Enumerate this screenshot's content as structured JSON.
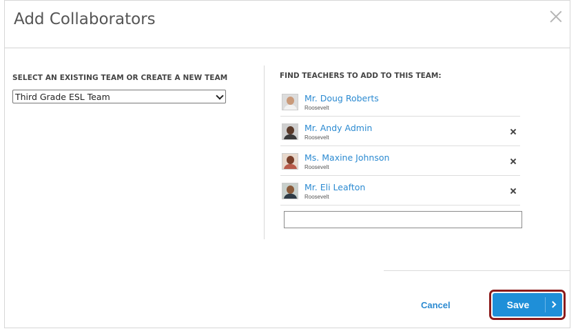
{
  "dialog": {
    "title": "Add Collaborators"
  },
  "left": {
    "label": "SELECT AN EXISTING TEAM OR CREATE A NEW TEAM",
    "selected_team": "Third Grade ESL Team"
  },
  "right": {
    "label": "FIND TEACHERS TO ADD TO THIS TEAM:",
    "teachers": [
      {
        "name": "Mr. Doug Roberts",
        "school": "Roosevelt",
        "removable": false
      },
      {
        "name": "Mr. Andy Admin",
        "school": "Roosevelt",
        "removable": true
      },
      {
        "name": "Ms. Maxine Johnson",
        "school": "Roosevelt",
        "removable": true
      },
      {
        "name": "Mr. Eli Leafton",
        "school": "Roosevelt",
        "removable": true
      }
    ],
    "search_value": ""
  },
  "footer": {
    "cancel_label": "Cancel",
    "save_label": "Save"
  },
  "colors": {
    "link": "#2b8ad1",
    "primary_button": "#1f8fd8",
    "highlight_outline": "#8b1a1a"
  },
  "icons": {
    "close": "close-icon",
    "remove": "remove-icon",
    "dropdown": "chevron-down-icon",
    "save_chevron": "chevron-right-icon"
  }
}
